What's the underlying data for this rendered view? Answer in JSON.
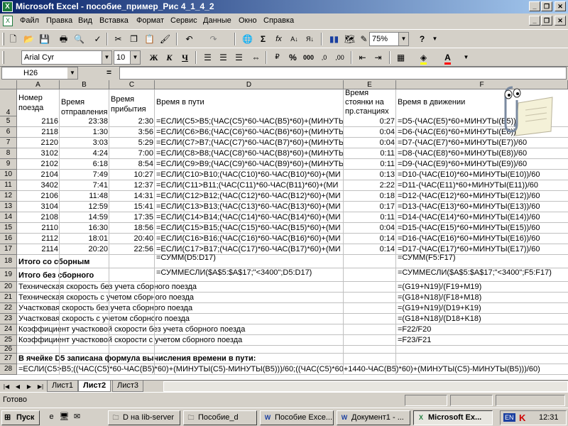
{
  "window": {
    "title": "Microsoft Excel - пособие_пример_Рис 4_1_4_2"
  },
  "menu": {
    "items": [
      "Файл",
      "Правка",
      "Вид",
      "Вставка",
      "Формат",
      "Сервис",
      "Данные",
      "Окно",
      "Справка"
    ]
  },
  "toolbar": {
    "zoom": "75%",
    "font_name": "Arial Cyr",
    "font_size": "10",
    "bold": "Ж",
    "italic": "К",
    "underline": "Ч",
    "percent": "%",
    "thousands": "000",
    "autosum": "Σ",
    "function": "fx"
  },
  "formula_bar": {
    "name_box": "H26",
    "equals": "=",
    "formula": ""
  },
  "sheet": {
    "columns": [
      "A",
      "B",
      "C",
      "D",
      "E",
      "F"
    ],
    "header_row": {
      "num": "4",
      "a": "Номер поезда",
      "b": "Время отправления",
      "c": "Время прибытия",
      "d": "Время в пути",
      "e": "Время стоянки на пр.станциях",
      "f": "Время в движении"
    },
    "rows": [
      {
        "num": "5",
        "a": "2116",
        "b": "23:38",
        "c": "2:30",
        "d": "=ЕСЛИ(C5>B5;(ЧАС(C5)*60-ЧАС(B5)*60)+(МИНУТЫ(",
        "e": "0:27",
        "f": "=D5-(ЧАС(E5)*60+МИНУТЫ(E5))/60"
      },
      {
        "num": "6",
        "a": "2118",
        "b": "1:30",
        "c": "3:56",
        "d": "=ЕСЛИ(C6>B6;(ЧАС(C6)*60-ЧАС(B6)*60)+(МИНУТЫ(",
        "e": "0:04",
        "f": "=D6-(ЧАС(E6)*60+МИНУТЫ(E6))/60"
      },
      {
        "num": "7",
        "a": "2120",
        "b": "3:03",
        "c": "5:29",
        "d": "=ЕСЛИ(C7>B7;(ЧАС(C7)*60-ЧАС(B7)*60)+(МИНУТЫ(",
        "e": "0:04",
        "f": "=D7-(ЧАС(E7)*60+МИНУТЫ(E7))/60"
      },
      {
        "num": "8",
        "a": "3102",
        "b": "4:24",
        "c": "7:00",
        "d": "=ЕСЛИ(C8>B8;(ЧАС(C8)*60-ЧАС(B8)*60)+(МИНУТЫ(",
        "e": "0:11",
        "f": "=D8-(ЧАС(E8)*60+МИНУТЫ(E8))/60"
      },
      {
        "num": "9",
        "a": "2102",
        "b": "6:18",
        "c": "8:54",
        "d": "=ЕСЛИ(C9>B9;(ЧАС(C9)*60-ЧАС(B9)*60)+(МИНУТЫ(",
        "e": "0:11",
        "f": "=D9-(ЧАС(E9)*60+МИНУТЫ(E9))/60"
      },
      {
        "num": "10",
        "a": "2104",
        "b": "7:49",
        "c": "10:27",
        "d": "=ЕСЛИ(C10>B10;(ЧАС(C10)*60-ЧАС(B10)*60)+(МИ",
        "e": "0:13",
        "f": "=D10-(ЧАС(E10)*60+МИНУТЫ(E10))/60"
      },
      {
        "num": "11",
        "a": "3402",
        "b": "7:41",
        "c": "12:37",
        "d": "=ЕСЛИ(C11>B11;(ЧАС(C11)*60-ЧАС(B11)*60)+(МИ",
        "e": "2:22",
        "f": "=D11-(ЧАС(E11)*60+МИНУТЫ(E11))/60"
      },
      {
        "num": "12",
        "a": "2106",
        "b": "11:48",
        "c": "14:31",
        "d": "=ЕСЛИ(C12>B12;(ЧАС(C12)*60-ЧАС(B12)*60)+(МИ",
        "e": "0:18",
        "f": "=D12-(ЧАС(E12)*60+МИНУТЫ(E12))/60"
      },
      {
        "num": "13",
        "a": "3104",
        "b": "12:59",
        "c": "15:41",
        "d": "=ЕСЛИ(C13>B13;(ЧАС(C13)*60-ЧАС(B13)*60)+(МИ",
        "e": "0:17",
        "f": "=D13-(ЧАС(E13)*60+МИНУТЫ(E13))/60"
      },
      {
        "num": "14",
        "a": "2108",
        "b": "14:59",
        "c": "17:35",
        "d": "=ЕСЛИ(C14>B14;(ЧАС(C14)*60-ЧАС(B14)*60)+(МИ",
        "e": "0:11",
        "f": "=D14-(ЧАС(E14)*60+МИНУТЫ(E14))/60"
      },
      {
        "num": "15",
        "a": "2110",
        "b": "16:30",
        "c": "18:56",
        "d": "=ЕСЛИ(C15>B15;(ЧАС(C15)*60-ЧАС(B15)*60)+(МИ",
        "e": "0:04",
        "f": "=D15-(ЧАС(E15)*60+МИНУТЫ(E15))/60"
      },
      {
        "num": "16",
        "a": "2112",
        "b": "18:01",
        "c": "20:40",
        "d": "=ЕСЛИ(C16>B16;(ЧАС(C16)*60-ЧАС(B16)*60)+(МИ",
        "e": "0:14",
        "f": "=D16-(ЧАС(E16)*60+МИНУТЫ(E16))/60"
      },
      {
        "num": "17",
        "a": "2114",
        "b": "20:20",
        "c": "22:56",
        "d": "=ЕСЛИ(C17>B17;(ЧАС(C17)*60-ЧАС(B17)*60)+(МИ",
        "e": "0:14",
        "f": "=D17-(ЧАС(E17)*60+МИНУТЫ(E17))/60"
      }
    ],
    "row18": {
      "num": "18",
      "a": "Итого со сборным",
      "d": "=СУММ(D5:D17)",
      "f": "=СУММ(F5:F17)"
    },
    "row19": {
      "num": "19",
      "a": "Итого без сборного",
      "d": "=СУММЕСЛИ($A$5:$A$17;\"<3400\";D5:D17)",
      "f": "=СУММЕСЛИ($A$5:$A$17;\"<3400\";F5:F17)"
    },
    "speed_rows": [
      {
        "num": "20",
        "a": "Техническая скорость без учета сборного поезда",
        "f": "=(G19+N19)/(F19+M19)"
      },
      {
        "num": "21",
        "a": "Техническая скорость с учетом сборного поезда",
        "f": "=(G18+N18)/(F18+M18)"
      },
      {
        "num": "22",
        "a": "Участковая скорость без учета сборного поезда",
        "f": "=(G19+N19)/(D19+K19)"
      },
      {
        "num": "23",
        "a": "Участковая скорость с учетом сборного поезда",
        "f": "=(G18+N18)/(D18+K18)"
      },
      {
        "num": "24",
        "a": "Коэффициент участковой скорости без учета сборного поезда",
        "f": "=F22/F20"
      },
      {
        "num": "25",
        "a": "Коэффициент участковой скорости с учетом сборного поезда",
        "f": "=F23/F21"
      }
    ],
    "row26": {
      "num": "26"
    },
    "row27": {
      "num": "27",
      "a": "В ячейке D5 записана формула вычисления времени в пути:"
    },
    "row28": {
      "num": "28",
      "a": "=ЕСЛИ(C5>B5;((ЧАС(C5)*60-ЧАС(B5)*60)+(МИНУТЫ(C5)-МИНУТЫ(B5)))/60;((ЧАС(C5)*60+1440-ЧАС(B5)*60)+(МИНУТЫ(C5)-МИНУТЫ(B5)))/60)"
    }
  },
  "sheet_tabs": [
    "Лист1",
    "Лист2",
    "Лист3"
  ],
  "active_tab": "Лист2",
  "status": {
    "text": "Готово"
  },
  "taskbar": {
    "start": "Пуск",
    "buttons": [
      "D на Iib-server",
      "Пособие_d",
      "Пособие Exce...",
      "Документ1 - ...",
      "Microsoft Ex..."
    ],
    "lang": "EN",
    "clock": "12:31"
  },
  "colors": {
    "title_start": "#0A246A",
    "title_end": "#A6CAF0",
    "excel_green": "#1E7B3C",
    "face": "#D4D0C8"
  }
}
